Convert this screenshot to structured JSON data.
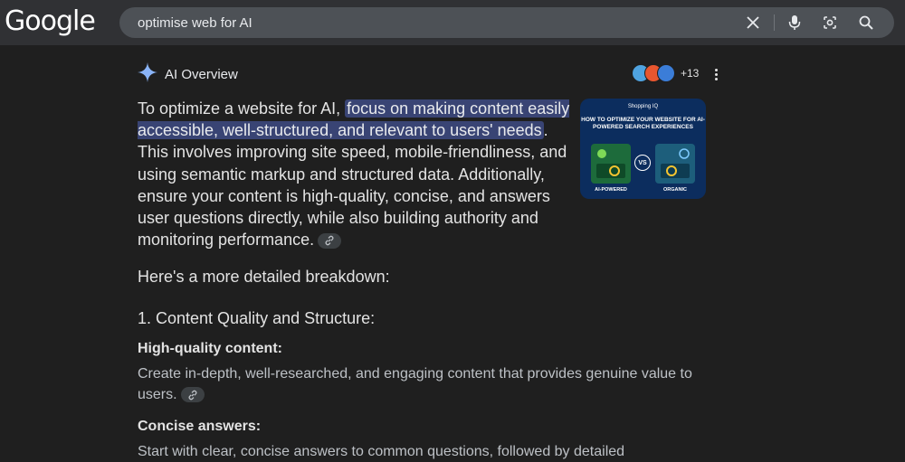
{
  "header": {
    "logo_text": "Google",
    "search_value": "optimise web for AI"
  },
  "icons": {
    "clear": "close-icon",
    "voice": "microphone-icon",
    "lens": "lens-camera-icon",
    "search": "search-icon",
    "overview": "sparkle-icon",
    "more": "more-vert-icon",
    "source_link": "link-icon"
  },
  "colors": {
    "background": "#1f1f1f",
    "highlight": "#394474",
    "sparkle_blue": "#8ab4f8",
    "thumbnail_bg": "#0c2d5e"
  },
  "overview": {
    "title": "AI Overview",
    "sources_count": "+13",
    "intro_before": "To optimize a website for AI, ",
    "intro_highlight": "focus on making content easily accessible, well-structured, and relevant to users' needs",
    "intro_after": ". This involves improving site speed, mobile-friendliness, and using semantic markup and structured data. Additionally, ensure your content is high-quality, concise, and answers user questions directly, while also building authority and monitoring performance.",
    "thumbnail": {
      "brand": "Shopping IQ",
      "title": "HOW TO OPTIMIZE YOUR WEBSITE FOR AI-POWERED SEARCH EXPERIENCES",
      "vs": "VS",
      "left_caption": "AI-POWERED",
      "right_caption": "ORGANIC"
    },
    "breakdown_intro": "Here's a more detailed breakdown:",
    "section_heading": "1. Content Quality and Structure:",
    "items": [
      {
        "heading": "High-quality content:",
        "text": "Create in-depth, well-researched, and engaging content that provides genuine value to users."
      },
      {
        "heading": "Concise answers:",
        "text": "Start with clear, concise answers to common questions, followed by detailed"
      }
    ]
  }
}
